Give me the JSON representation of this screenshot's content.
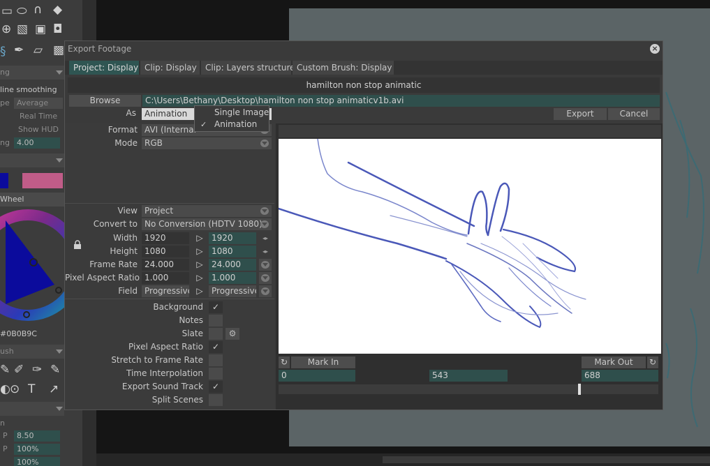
{
  "dialog": {
    "title": "Export Footage",
    "tabs": [
      "Project: Display",
      "Clip: Display",
      "Clip: Layers structure",
      "Custom Brush: Display"
    ],
    "active_tab": 0,
    "filename": "hamilton non stop animatic",
    "browse_label": "Browse",
    "path": "C:\\Users\\Bethany\\Desktop\\hamilton non stop animaticv1b.avi",
    "as_label": "As",
    "as_value": "Animation",
    "as_options": [
      "Single Image",
      "Animation"
    ],
    "as_selected": "Animation",
    "export_label": "Export",
    "cancel_label": "Cancel",
    "format_label": "Format",
    "format_value": "AVI (Internal",
    "mode_label": "Mode",
    "mode_value": "RGB",
    "view_label": "View",
    "view_value": "Project",
    "convert_label": "Convert to",
    "convert_value": "No Conversion (HDTV 1080)",
    "rows": [
      {
        "label": "Width",
        "src": "1920",
        "dst": "1920"
      },
      {
        "label": "Height",
        "src": "1080",
        "dst": "1080"
      },
      {
        "label": "Frame Rate",
        "src": "24.000",
        "dst": "24.000"
      },
      {
        "label": "Pixel Aspect Ratio",
        "src": "1.000",
        "dst": "1.000"
      },
      {
        "label": "Field",
        "src": "Progressive",
        "dst": "Progressive"
      }
    ],
    "options": [
      {
        "label": "Background",
        "checked": true
      },
      {
        "label": "Notes",
        "checked": false
      },
      {
        "label": "Slate",
        "checked": false
      },
      {
        "label": "Pixel Aspect Ratio",
        "checked": true
      },
      {
        "label": "Stretch to Frame Rate",
        "checked": false
      },
      {
        "label": "Time Interpolation",
        "checked": false
      },
      {
        "label": "Export Sound Track",
        "checked": true
      },
      {
        "label": "Split Scenes",
        "checked": false
      }
    ],
    "mark_in_label": "Mark In",
    "mark_out_label": "Mark Out",
    "mark_in_value": "0",
    "current_frame": "543",
    "mark_out_value": "688",
    "check_glyph": "✓"
  },
  "background": {
    "labels": {
      "l1": "ng",
      "l2": "line smoothing",
      "l3": "pe",
      "l3v": "Average",
      "l4": "Real Time",
      "l5": "Show HUD",
      "l6": "ng",
      "l6v": "4.00",
      "l7": "Wheel",
      "l8": "#0B0B9C",
      "l9": "ush",
      "l10": "n",
      "p1": "P",
      "p1v": "8.50",
      "p2": "P",
      "p2v": "100%",
      "p3v": "100%"
    }
  },
  "colors": {
    "accent_tab": "#2f5552",
    "field": "#2f4f4c",
    "stroke": "#4a58b8",
    "swatch_blue": "#0B0B9C",
    "swatch_pink": "#c05c88"
  }
}
